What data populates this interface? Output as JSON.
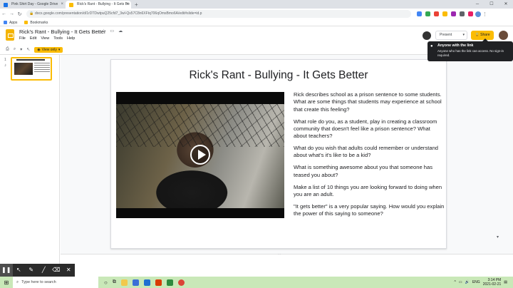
{
  "browser": {
    "tabs": [
      {
        "label": "Pink Shirt Day - Google Drive",
        "active": false,
        "icon": "drive-icon",
        "color": "#1a73e8"
      },
      {
        "label": "Rick's Rant - Bullying - It Gets Be",
        "active": true,
        "icon": "slides-icon",
        "color": "#fbbc04"
      }
    ],
    "url": "docs.google.com/presentation/d/1rDTDwtpuQ25cfd7_3wl-Qs57C8n6XFtq706qOmsBmo6A/edit#slide=id.p",
    "bookmarks": [
      "Apps",
      "Bookmarks"
    ]
  },
  "slides_app": {
    "doc_title": "Rick's Rant - Bullying - It Gets Better",
    "menus": [
      "File",
      "Edit",
      "View",
      "Tools",
      "Help"
    ],
    "present_label": "Present",
    "share_label": "Share",
    "view_only_label": "View only",
    "slide_number": "1"
  },
  "share_popup": {
    "heading": "Anyone with the link",
    "description": "Anyone who has the link can access. No sign-in required."
  },
  "slide": {
    "title": "Rick's Rant - Bullying - It Gets Better",
    "questions": [
      "Rick describes school as a prison sentence to some students. What are some things that students may experience at school that create this feeling?",
      "What role do you, as a student, play in creating a classroom community that doesn't feel like a prison sentence? What about teachers?",
      "What do you wish that adults could remember or understand about what's it's like to be a kid?",
      "What is something awesome about you that someone has teased you about?",
      "Make a list of 10 things you are looking forward to doing when you are an adult.",
      "\"It gets better\" is a very popular saying. How would you explain the power of this saying to someone?"
    ]
  },
  "taskbar": {
    "search_placeholder": "Type here to search",
    "language": "ENG",
    "time": "3:14 PM",
    "date": "2021-02-21"
  }
}
